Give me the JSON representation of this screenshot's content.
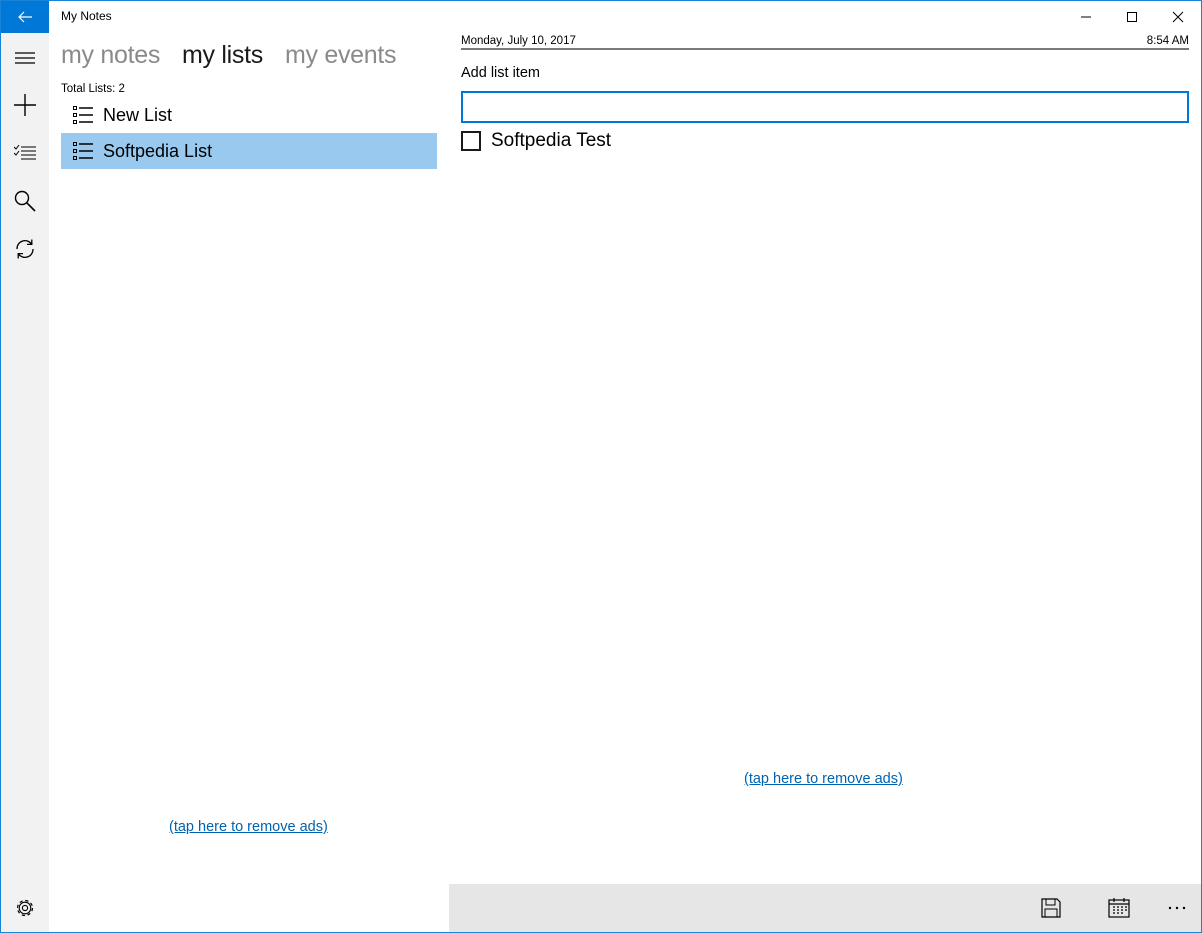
{
  "window": {
    "title": "My Notes"
  },
  "pivot": {
    "tabs": [
      "my notes",
      "my lists",
      "my events"
    ],
    "active": "my lists"
  },
  "lists": {
    "total_label": "Total Lists: 2",
    "items": [
      {
        "label": "New List",
        "selected": false
      },
      {
        "label": "Softpedia List",
        "selected": true
      }
    ]
  },
  "detail": {
    "date": "Monday, July 10, 2017",
    "time": "8:54 AM",
    "add_label": "Add list item",
    "input_value": "",
    "items": [
      {
        "label": "Softpedia Test",
        "checked": false
      }
    ]
  },
  "ads": {
    "left_link": "(tap here to remove ads)",
    "right_link": "(tap here to remove ads)"
  },
  "icons": {
    "rail": [
      "hamburger-icon",
      "plus-icon",
      "checklist-icon",
      "search-icon",
      "sync-icon",
      "settings-icon"
    ],
    "commands": [
      "save-icon",
      "calendar-icon",
      "more-icon"
    ]
  },
  "colors": {
    "accent": "#0078d7",
    "selection": "#99c9ef",
    "link": "#0063b1",
    "rail_bg": "#f2f2f2",
    "cmdbar_bg": "#e6e6e6"
  }
}
